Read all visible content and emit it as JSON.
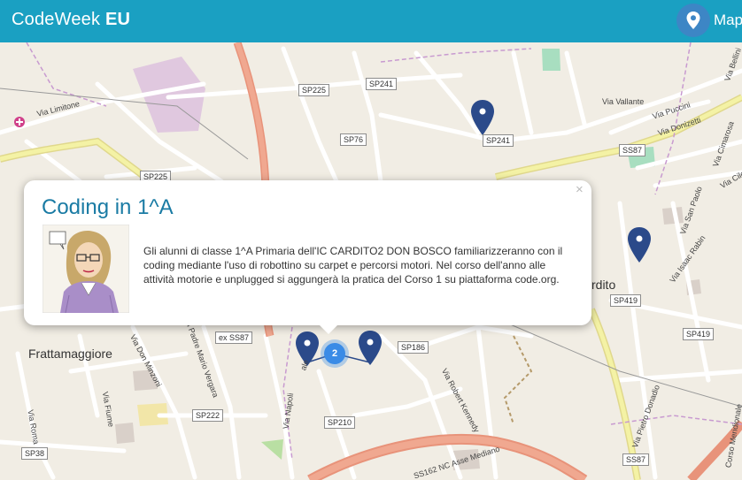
{
  "header": {
    "brand_main": "CodeWeek",
    "brand_sub": "EU",
    "map_label": "Map"
  },
  "map": {
    "towns": {
      "frattamaggiore": "Frattamaggiore",
      "cardito": "rdito"
    },
    "road_labels": {
      "sp225_a": "SP225",
      "sp241_a": "SP241",
      "sp241_b": "SP241",
      "sp76": "SP76",
      "sp225_b": "SP225",
      "ss87_a": "SS87",
      "sp419_a": "SP419",
      "sp419_b": "SP419",
      "ex_ss87": "ex SS87",
      "sp186": "SP186",
      "sp222": "SP222",
      "sp210": "SP210",
      "sp38": "SP38",
      "ss87_b": "SS87"
    },
    "streets": {
      "via_limitone": "Via Limitone",
      "via_vallante": "Via Vallante",
      "via_puccini": "Via Puccini",
      "via_donizetti": "Via Donizetti",
      "via_cimarosa": "Via Cimarosa",
      "via_bellini": "Via Bellini",
      "via_cile": "Via Cile",
      "via_san_paolo": "Via San Paolo",
      "via_isaac_rabin": "Via Isaac Rabin",
      "via_padre_mario_vergara": "Via Padre Mario Vergara",
      "via_don_minzoni": "Via Don Minzoni",
      "via_fiume": "Via Fiume",
      "via_roma": "Via Roma",
      "via_napoli": "Via Napoli",
      "via_robert_kennedy": "Via Robert Kennedy",
      "via_pietro_donadio": "Via Pietro Donadio",
      "corso_meridionale": "Corso Meridionale",
      "asse_mediano": "SS162 NC Asse Mediano",
      "via_fragment": "ale"
    },
    "cluster_count": "2",
    "marker_icon": "map-pin-icon"
  },
  "popup": {
    "title": "Coding in 1^A",
    "description": "Gli alunni di classe 1^A Primaria dell'IC CARDITO2 DON BOSCO familiarizzeranno con il coding mediante l'uso di robottino su carpet e percorsi motori. Nel corso dell'anno alle attività motorie e unplugged si aggungerà la pratica del Corso 1 su piattaforma code.org.",
    "close_label": "×",
    "image_icon": "cartoon-teacher-image"
  },
  "colors": {
    "header": "#1aa0c2",
    "accent_title": "#1a7ba4",
    "marker": "#2b4a8a",
    "cluster": "#3a8be6",
    "highway": "#e8937a",
    "secondary_road": "#f4f2a5"
  }
}
